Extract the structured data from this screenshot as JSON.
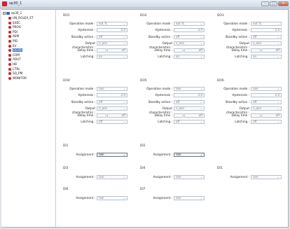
{
  "window": {
    "title": "op30_1",
    "min": "–",
    "max": "□",
    "close": "✕"
  },
  "tree": {
    "root": "op30_1",
    "items": [
      "UN_RGLEX_ET",
      "EXEC",
      "PROG",
      "PDI",
      "REM",
      "PID",
      "EV",
      "DO/DI",
      "COM",
      "AOUT",
      "HB",
      "CTRL",
      "SQ_PM",
      "MONITOR"
    ],
    "selected_index": 7
  },
  "labels": {
    "operation_mode": "Operation mode :",
    "hysteresis": "Hysteresis :",
    "standby_action": "Standby action :",
    "output_char": "Output characteristics :",
    "delay_time": "Delay time :",
    "latching": "Latching :",
    "assignment": "Assignment :"
  },
  "do_groups": [
    {
      "title": "DO1",
      "operation_mode": "out TL",
      "hysteresis": "2.0",
      "standby": "off",
      "output_char": "n_ann",
      "delay_a": "",
      "delay_b": "off",
      "latching": "on"
    },
    {
      "title": "DO2",
      "operation_mode": "out TL",
      "hysteresis": "2.0",
      "standby": "off",
      "output_char": "n_ann",
      "delay_a": "",
      "delay_b": "off",
      "latching": "on"
    },
    {
      "title": "DO3",
      "operation_mode": "out TL",
      "hysteresis": "2.0",
      "standby": "off",
      "output_char": "n_ann",
      "delay_a": "",
      "delay_b": "off",
      "latching": "on"
    },
    {
      "title": "DO4",
      "operation_mode": "non",
      "hysteresis": "2.0",
      "standby": "off",
      "output_char": "n_ann",
      "delay_a": "",
      "delay_b": "off",
      "latching": "off"
    },
    {
      "title": "DO5",
      "operation_mode": "non",
      "hysteresis": "2.0",
      "standby": "off",
      "output_char": "n_ann",
      "delay_a": "",
      "delay_b": "off",
      "latching": "off"
    },
    {
      "title": "DO6",
      "operation_mode": "non",
      "hysteresis": "2.0",
      "standby": "off",
      "output_char": "n_ann",
      "delay_a": "",
      "delay_b": "off",
      "latching": "off"
    }
  ],
  "di_groups": [
    {
      "title": "DI1",
      "assignment": "non",
      "active": true
    },
    {
      "title": "DI2",
      "assignment": "non",
      "active": true
    },
    {
      "title": "DI3",
      "assignment": "non",
      "active": false
    },
    {
      "title": "DI4",
      "assignment": "non",
      "active": false
    },
    {
      "title": "DI5",
      "assignment": "non",
      "active": false
    },
    {
      "title": "DI6",
      "assignment": "non",
      "active": false
    },
    {
      "title": "DI7",
      "assignment": "non",
      "active": false
    }
  ],
  "arrow": "⌄"
}
